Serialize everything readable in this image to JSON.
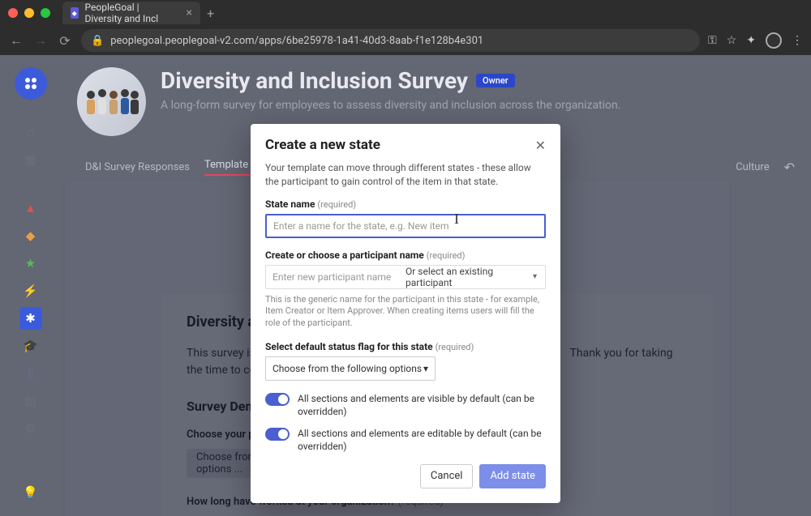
{
  "browser": {
    "tab_title": "PeopleGoal | Diversity and Incl",
    "url": "peoplegoal.peoplegoal-v2.com/apps/6be25978-1a41-40d3-8aab-f1e128b4e301"
  },
  "page": {
    "title": "Diversity and Inclusion Survey",
    "owner_badge": "Owner",
    "subtitle": "A long-form survey for employees to assess diversity and inclusion across the organization.",
    "tabs": {
      "responses": "D&I Survey Responses",
      "template": "Template",
      "culture": "Culture"
    }
  },
  "survey": {
    "heading": "Diversity and",
    "body_pre": "This survey is a",
    "body_post": "Thank you for taking the time to complet",
    "demographics_heading": "Survey Dem",
    "q1_label": "Choose your posit",
    "q1_select": "Choose from the following options ...",
    "q2_label": "How long have worked at your organization?",
    "required": "(required)"
  },
  "modal": {
    "title": "Create a new state",
    "description": "Your template can move through different states - these allow the participant to gain control of the item in that state.",
    "state_name_label": "State name",
    "state_name_placeholder": "Enter a name for the state, e.g. New item",
    "participant_label": "Create or choose a participant name",
    "participant_placeholder": "Enter new participant name",
    "participant_or": "Or select an existing participant",
    "participant_help": "This is the generic name for the participant in this state - for example, Item Creator or Item Approver. When creating items users will fill the role of the participant.",
    "status_label": "Select default status flag for this state",
    "status_select": "Choose from the following options",
    "toggle_visible": "All sections and elements are visible by default (can be overridden)",
    "toggle_editable": "All sections and elements are editable by default (can be overridden)",
    "required": "(required)",
    "cancel": "Cancel",
    "add": "Add state"
  }
}
